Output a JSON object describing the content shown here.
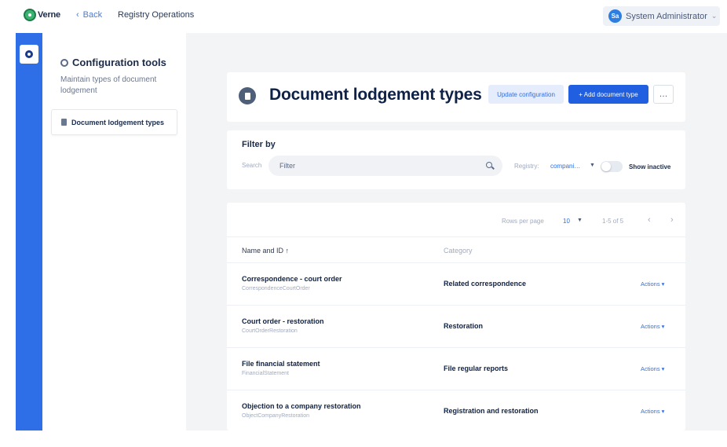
{
  "topbar": {
    "logo_text": "Verne",
    "back_label": "Back",
    "app_title": "Registry Operations",
    "user": {
      "initials": "Sa",
      "name": "System Administrator"
    }
  },
  "sidebar": {
    "title": "Configuration tools",
    "description": "Maintain types of document lodgement",
    "items": [
      {
        "label": "Document lodgement types",
        "selected": true
      }
    ]
  },
  "header": {
    "title": "Document lodgement types",
    "update_label": "Update configuration",
    "add_label": "+ Add document type",
    "more_label": "…"
  },
  "filter": {
    "title": "Filter by",
    "search_label": "Search",
    "search_placeholder": "Filter",
    "registry_label": "Registry:",
    "registry_value": "compani…",
    "show_inactive_label": "Show inactive",
    "show_inactive": false
  },
  "pagination": {
    "rows_per_page_label": "Rows per page",
    "rows_per_page": "10",
    "range": "1-5 of 5"
  },
  "table": {
    "columns": [
      "Name and ID ↑",
      "Category"
    ],
    "rows": [
      {
        "name": "Correspondence - court order",
        "id": "CorrespondenceCourtOrder",
        "category": "Related correspondence",
        "actions": "Actions ▾"
      },
      {
        "name": "Court order - restoration",
        "id": "CourtOrderRestoration",
        "category": "Restoration",
        "actions": "Actions ▾"
      },
      {
        "name": "File financial statement",
        "id": "FinancialStatement",
        "category": "File regular reports",
        "actions": "Actions ▾"
      },
      {
        "name": "Objection to a company restoration",
        "id": "ObjectCompanyRestoration",
        "category": "Registration and restoration",
        "actions": "Actions ▾"
      }
    ]
  },
  "colors": {
    "primary": "#1f5fe0",
    "rail": "#2e6fe8",
    "logo": "#3cb371",
    "text_dark": "#0e2147",
    "background": "#f3f4f6"
  }
}
